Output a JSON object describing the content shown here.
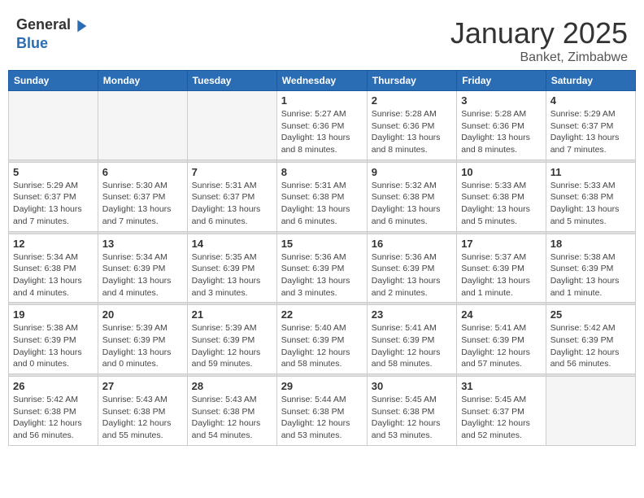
{
  "header": {
    "logo_general": "General",
    "logo_blue": "Blue",
    "month": "January 2025",
    "location": "Banket, Zimbabwe"
  },
  "weekdays": [
    "Sunday",
    "Monday",
    "Tuesday",
    "Wednesday",
    "Thursday",
    "Friday",
    "Saturday"
  ],
  "weeks": [
    [
      {
        "day": "",
        "info": ""
      },
      {
        "day": "",
        "info": ""
      },
      {
        "day": "",
        "info": ""
      },
      {
        "day": "1",
        "info": "Sunrise: 5:27 AM\nSunset: 6:36 PM\nDaylight: 13 hours\nand 8 minutes."
      },
      {
        "day": "2",
        "info": "Sunrise: 5:28 AM\nSunset: 6:36 PM\nDaylight: 13 hours\nand 8 minutes."
      },
      {
        "day": "3",
        "info": "Sunrise: 5:28 AM\nSunset: 6:36 PM\nDaylight: 13 hours\nand 8 minutes."
      },
      {
        "day": "4",
        "info": "Sunrise: 5:29 AM\nSunset: 6:37 PM\nDaylight: 13 hours\nand 7 minutes."
      }
    ],
    [
      {
        "day": "5",
        "info": "Sunrise: 5:29 AM\nSunset: 6:37 PM\nDaylight: 13 hours\nand 7 minutes."
      },
      {
        "day": "6",
        "info": "Sunrise: 5:30 AM\nSunset: 6:37 PM\nDaylight: 13 hours\nand 7 minutes."
      },
      {
        "day": "7",
        "info": "Sunrise: 5:31 AM\nSunset: 6:37 PM\nDaylight: 13 hours\nand 6 minutes."
      },
      {
        "day": "8",
        "info": "Sunrise: 5:31 AM\nSunset: 6:38 PM\nDaylight: 13 hours\nand 6 minutes."
      },
      {
        "day": "9",
        "info": "Sunrise: 5:32 AM\nSunset: 6:38 PM\nDaylight: 13 hours\nand 6 minutes."
      },
      {
        "day": "10",
        "info": "Sunrise: 5:33 AM\nSunset: 6:38 PM\nDaylight: 13 hours\nand 5 minutes."
      },
      {
        "day": "11",
        "info": "Sunrise: 5:33 AM\nSunset: 6:38 PM\nDaylight: 13 hours\nand 5 minutes."
      }
    ],
    [
      {
        "day": "12",
        "info": "Sunrise: 5:34 AM\nSunset: 6:38 PM\nDaylight: 13 hours\nand 4 minutes."
      },
      {
        "day": "13",
        "info": "Sunrise: 5:34 AM\nSunset: 6:39 PM\nDaylight: 13 hours\nand 4 minutes."
      },
      {
        "day": "14",
        "info": "Sunrise: 5:35 AM\nSunset: 6:39 PM\nDaylight: 13 hours\nand 3 minutes."
      },
      {
        "day": "15",
        "info": "Sunrise: 5:36 AM\nSunset: 6:39 PM\nDaylight: 13 hours\nand 3 minutes."
      },
      {
        "day": "16",
        "info": "Sunrise: 5:36 AM\nSunset: 6:39 PM\nDaylight: 13 hours\nand 2 minutes."
      },
      {
        "day": "17",
        "info": "Sunrise: 5:37 AM\nSunset: 6:39 PM\nDaylight: 13 hours\nand 1 minute."
      },
      {
        "day": "18",
        "info": "Sunrise: 5:38 AM\nSunset: 6:39 PM\nDaylight: 13 hours\nand 1 minute."
      }
    ],
    [
      {
        "day": "19",
        "info": "Sunrise: 5:38 AM\nSunset: 6:39 PM\nDaylight: 13 hours\nand 0 minutes."
      },
      {
        "day": "20",
        "info": "Sunrise: 5:39 AM\nSunset: 6:39 PM\nDaylight: 13 hours\nand 0 minutes."
      },
      {
        "day": "21",
        "info": "Sunrise: 5:39 AM\nSunset: 6:39 PM\nDaylight: 12 hours\nand 59 minutes."
      },
      {
        "day": "22",
        "info": "Sunrise: 5:40 AM\nSunset: 6:39 PM\nDaylight: 12 hours\nand 58 minutes."
      },
      {
        "day": "23",
        "info": "Sunrise: 5:41 AM\nSunset: 6:39 PM\nDaylight: 12 hours\nand 58 minutes."
      },
      {
        "day": "24",
        "info": "Sunrise: 5:41 AM\nSunset: 6:39 PM\nDaylight: 12 hours\nand 57 minutes."
      },
      {
        "day": "25",
        "info": "Sunrise: 5:42 AM\nSunset: 6:39 PM\nDaylight: 12 hours\nand 56 minutes."
      }
    ],
    [
      {
        "day": "26",
        "info": "Sunrise: 5:42 AM\nSunset: 6:38 PM\nDaylight: 12 hours\nand 56 minutes."
      },
      {
        "day": "27",
        "info": "Sunrise: 5:43 AM\nSunset: 6:38 PM\nDaylight: 12 hours\nand 55 minutes."
      },
      {
        "day": "28",
        "info": "Sunrise: 5:43 AM\nSunset: 6:38 PM\nDaylight: 12 hours\nand 54 minutes."
      },
      {
        "day": "29",
        "info": "Sunrise: 5:44 AM\nSunset: 6:38 PM\nDaylight: 12 hours\nand 53 minutes."
      },
      {
        "day": "30",
        "info": "Sunrise: 5:45 AM\nSunset: 6:38 PM\nDaylight: 12 hours\nand 53 minutes."
      },
      {
        "day": "31",
        "info": "Sunrise: 5:45 AM\nSunset: 6:37 PM\nDaylight: 12 hours\nand 52 minutes."
      },
      {
        "day": "",
        "info": ""
      }
    ]
  ]
}
